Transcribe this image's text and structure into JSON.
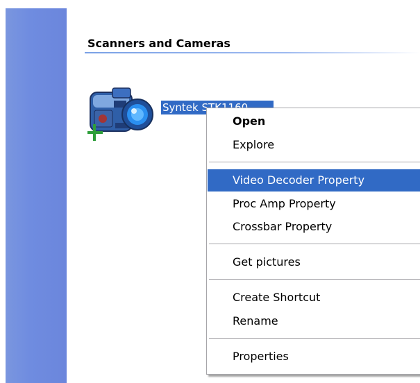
{
  "section": {
    "title": "Scanners and Cameras"
  },
  "device": {
    "label": "Syntek STK1160",
    "icon": "webcam-icon"
  },
  "context_menu": {
    "open": "Open",
    "explore": "Explore",
    "video_decoder_property": "Video Decoder Property",
    "proc_amp_property": "Proc Amp Property",
    "crossbar_property": "Crossbar Property",
    "get_pictures": "Get pictures",
    "create_shortcut": "Create Shortcut",
    "rename": "Rename",
    "properties": "Properties",
    "highlighted_item": "Video Decoder Property"
  },
  "colors": {
    "sidebar": "#6f8ce0",
    "selection": "#316ac5",
    "section_rule": "#7aa1e6"
  }
}
